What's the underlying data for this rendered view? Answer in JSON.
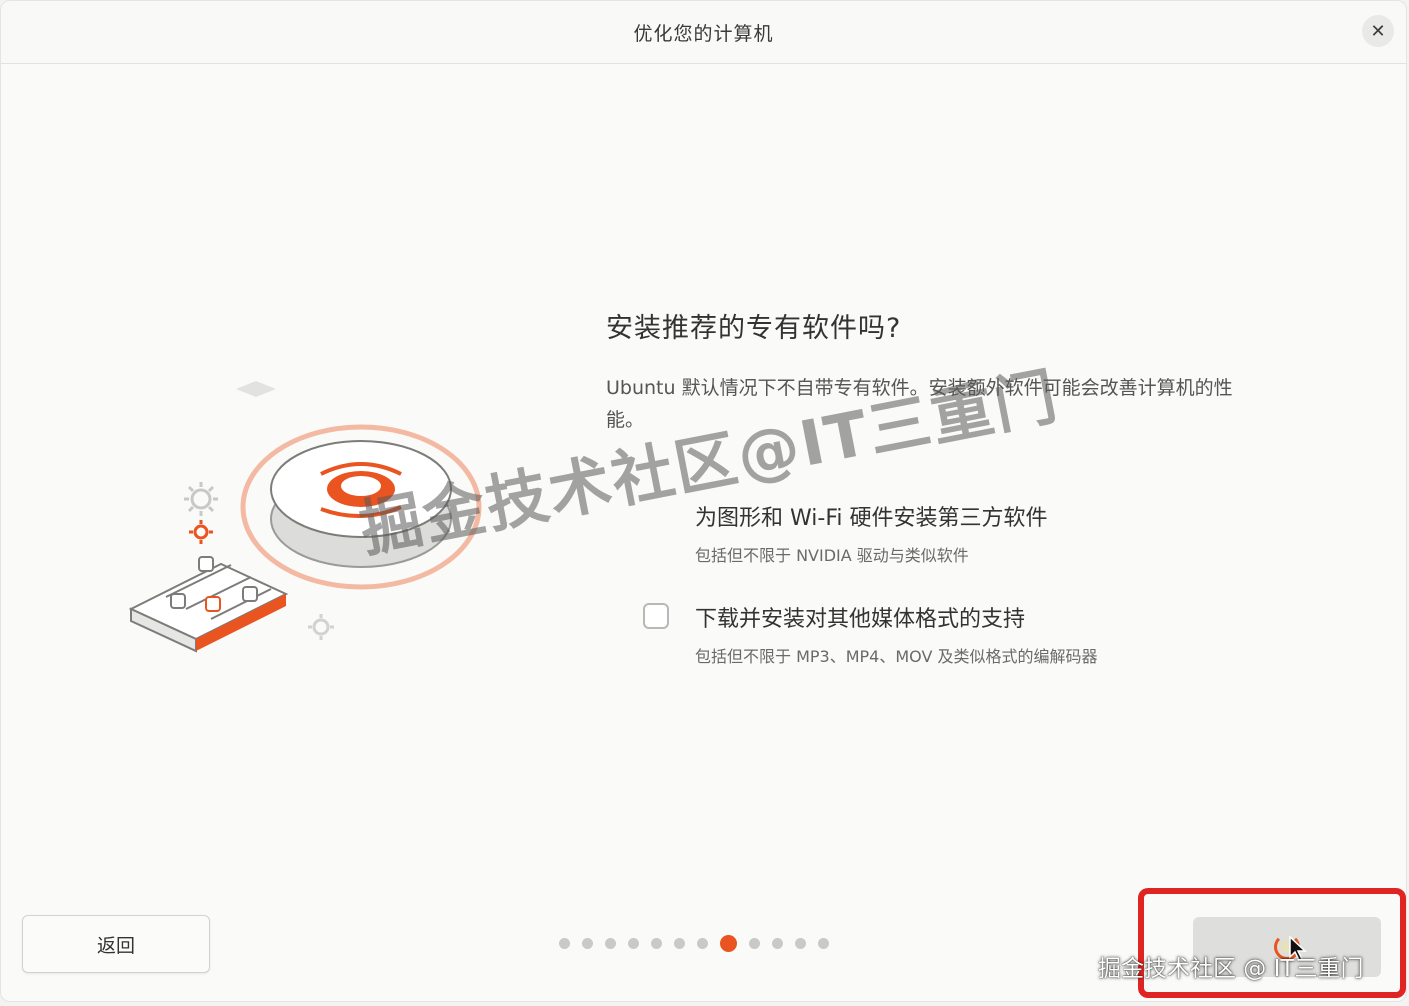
{
  "window": {
    "title": "优化您的计算机",
    "close_icon": "✕"
  },
  "main": {
    "heading": "安装推荐的专有软件吗?",
    "description": "Ubuntu 默认情况下不自带专有软件。安装额外软件可能会改善计算机的性能。",
    "options": [
      {
        "label": "为图形和 Wi-Fi 硬件安装第三方软件",
        "sublabel": "包括但不限于 NVIDIA 驱动与类似软件",
        "checked": false
      },
      {
        "label": "下载并安装对其他媒体格式的支持",
        "sublabel": "包括但不限于 MP3、MP4、MOV 及类似格式的编解码器",
        "checked": false
      }
    ]
  },
  "footer": {
    "back_label": "返回",
    "next_state": "loading",
    "page_dots": {
      "total": 12,
      "current": 8
    }
  },
  "watermark": {
    "center_text": "掘金技术社区@IT三重门",
    "corner_text": "掘金技术社区 @ IT三重门"
  },
  "colors": {
    "accent": "#e95420",
    "highlight": "#e02424"
  }
}
